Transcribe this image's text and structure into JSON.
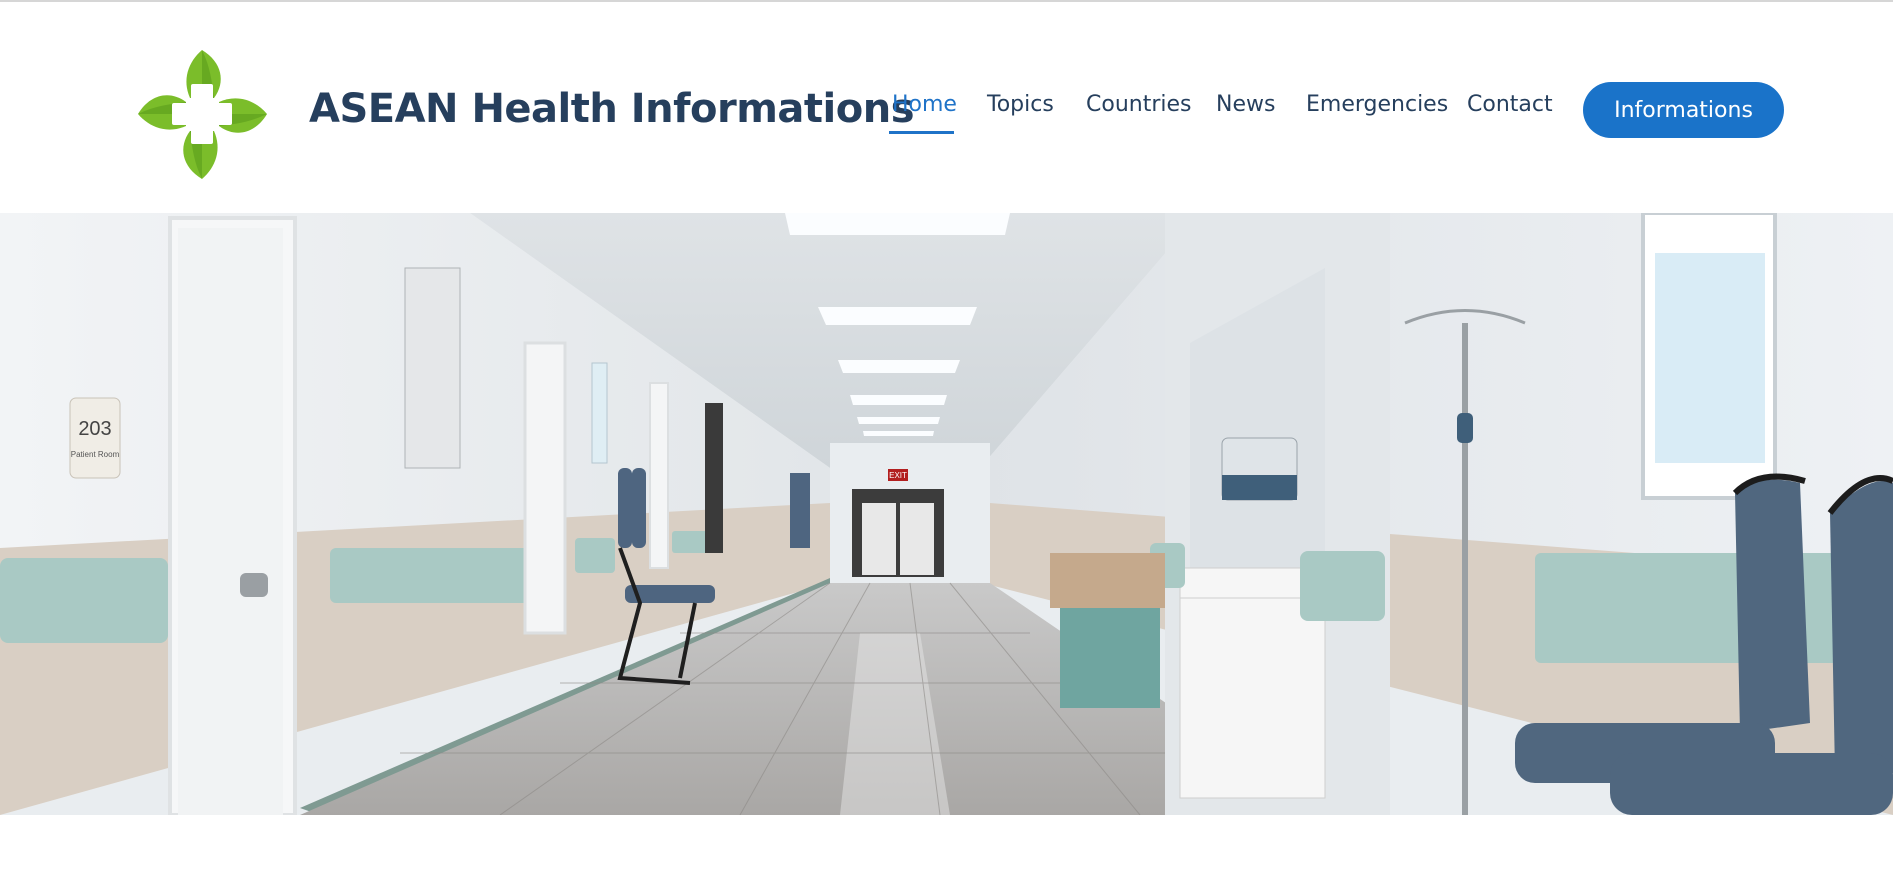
{
  "header": {
    "brand_title": "ASEAN Health Informations",
    "logo_icon": "green-leaf-cross-icon",
    "nav": [
      {
        "label": "Home",
        "active": true
      },
      {
        "label": "Topics",
        "active": false
      },
      {
        "label": "Countries",
        "active": false
      },
      {
        "label": "News",
        "active": false
      },
      {
        "label": "Emergencies",
        "active": false
      },
      {
        "label": "Contact",
        "active": false
      }
    ],
    "cta_label": "Informations"
  },
  "hero": {
    "room_number": "203",
    "room_label": "Patient Room",
    "exit_sign": "EXIT"
  },
  "colors": {
    "brand_navy": "#263f5d",
    "accent_blue": "#1a73c9",
    "logo_green": "#7bbd2a"
  }
}
